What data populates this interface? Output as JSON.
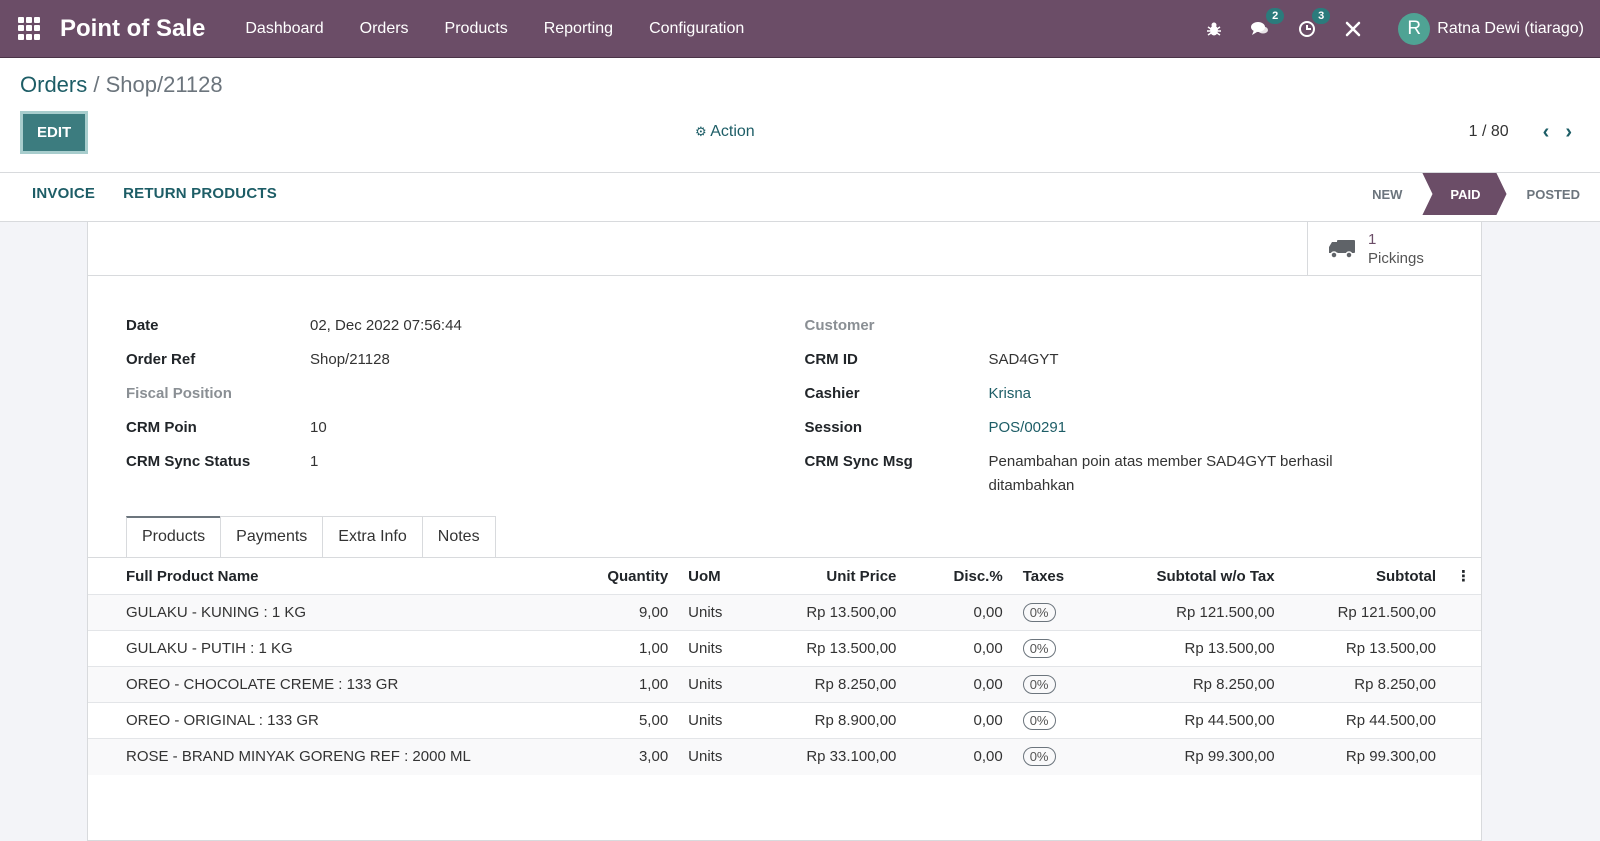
{
  "navbar": {
    "app_title": "Point of Sale",
    "menu": [
      "Dashboard",
      "Orders",
      "Products",
      "Reporting",
      "Configuration"
    ],
    "messages_count": "2",
    "activities_count": "3",
    "user_initial": "R",
    "user_name": "Ratna Dewi (tiarago)",
    "accent_color": "#6b4d67"
  },
  "breadcrumb": {
    "parent": "Orders",
    "separator": " / ",
    "current": "Shop/21128"
  },
  "toolbar": {
    "edit_label": "EDIT",
    "action_label": "Action",
    "pager_value": "1 / 80"
  },
  "statusbar": {
    "buttons": [
      "INVOICE",
      "RETURN PRODUCTS"
    ],
    "stages": [
      "NEW",
      "PAID",
      "POSTED"
    ],
    "active_stage": "PAID"
  },
  "smart_button": {
    "count": "1",
    "label": "Pickings"
  },
  "fields_left": [
    {
      "label": "Date",
      "value": "02, Dec 2022 07:56:44"
    },
    {
      "label": "Order Ref",
      "value": "Shop/21128"
    },
    {
      "label": "Fiscal Position",
      "value": ""
    },
    {
      "label": "CRM Poin",
      "value": "10"
    },
    {
      "label": "CRM Sync Status",
      "value": "1"
    }
  ],
  "fields_right": [
    {
      "label": "Customer",
      "value": ""
    },
    {
      "label": "CRM ID",
      "value": "SAD4GYT"
    },
    {
      "label": "Cashier",
      "value": "Krisna"
    },
    {
      "label": "Session",
      "value": "POS/00291"
    },
    {
      "label": "CRM Sync Msg",
      "value": "Penambahan poin atas member SAD4GYT berhasil ditambahkan"
    }
  ],
  "tabs": [
    "Products",
    "Payments",
    "Extra Info",
    "Notes"
  ],
  "table": {
    "columns": [
      "Full Product Name",
      "Quantity",
      "UoM",
      "Unit Price",
      "Disc.%",
      "Taxes",
      "Subtotal w/o Tax",
      "Subtotal"
    ],
    "rows": [
      {
        "name": "GULAKU - KUNING : 1 KG",
        "qty": "9,00",
        "uom": "Units",
        "price": "Rp 13.500,00",
        "disc": "0,00",
        "tax": "0%",
        "subtotal_wo": "Rp 121.500,00",
        "subtotal": "Rp 121.500,00"
      },
      {
        "name": "GULAKU - PUTIH : 1 KG",
        "qty": "1,00",
        "uom": "Units",
        "price": "Rp 13.500,00",
        "disc": "0,00",
        "tax": "0%",
        "subtotal_wo": "Rp 13.500,00",
        "subtotal": "Rp 13.500,00"
      },
      {
        "name": "OREO - CHOCOLATE CREME : 133 GR",
        "qty": "1,00",
        "uom": "Units",
        "price": "Rp 8.250,00",
        "disc": "0,00",
        "tax": "0%",
        "subtotal_wo": "Rp 8.250,00",
        "subtotal": "Rp 8.250,00"
      },
      {
        "name": "OREO - ORIGINAL : 133 GR",
        "qty": "5,00",
        "uom": "Units",
        "price": "Rp 8.900,00",
        "disc": "0,00",
        "tax": "0%",
        "subtotal_wo": "Rp 44.500,00",
        "subtotal": "Rp 44.500,00"
      },
      {
        "name": "ROSE - BRAND MINYAK GORENG REF : 2000 ML",
        "qty": "3,00",
        "uom": "Units",
        "price": "Rp 33.100,00",
        "disc": "0,00",
        "tax": "0%",
        "subtotal_wo": "Rp 99.300,00",
        "subtotal": "Rp 99.300,00"
      }
    ]
  }
}
